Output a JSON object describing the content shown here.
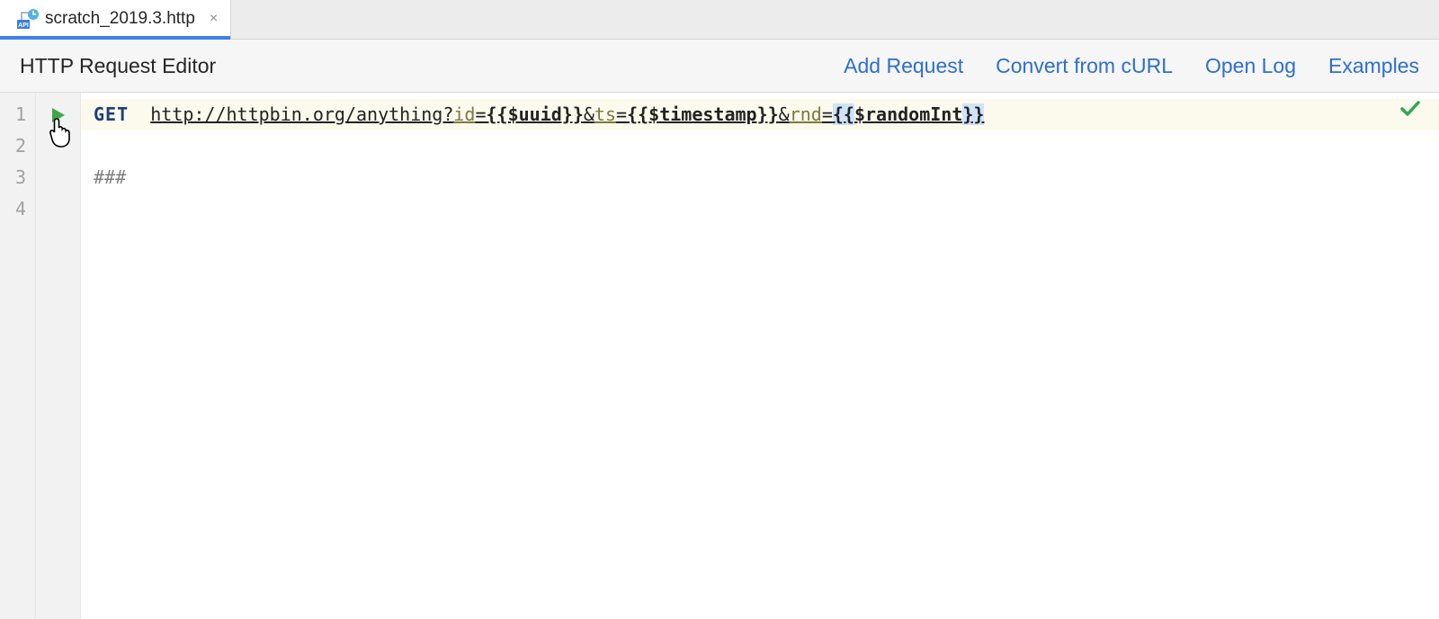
{
  "tab": {
    "filename": "scratch_2019.3.http",
    "close_glyph": "×"
  },
  "toolbar": {
    "title": "HTTP Request Editor",
    "links": {
      "add_request": "Add Request",
      "convert_curl": "Convert from cURL",
      "open_log": "Open Log",
      "examples": "Examples"
    }
  },
  "editor": {
    "line_numbers": [
      "1",
      "2",
      "3",
      "4"
    ],
    "line1": {
      "method": "GET",
      "url_base": "http://httpbin.org/anything?",
      "p1_key": "id",
      "eq": "=",
      "p1_val": "{{$uuid}}",
      "amp": "&",
      "p2_key": "ts",
      "p2_val": "{{$timestamp}}",
      "p3_key": "rnd",
      "p3_val_open": "{{",
      "p3_val_mid": "$randomInt",
      "p3_val_close": "}}"
    },
    "line3": {
      "separator": "###"
    }
  }
}
